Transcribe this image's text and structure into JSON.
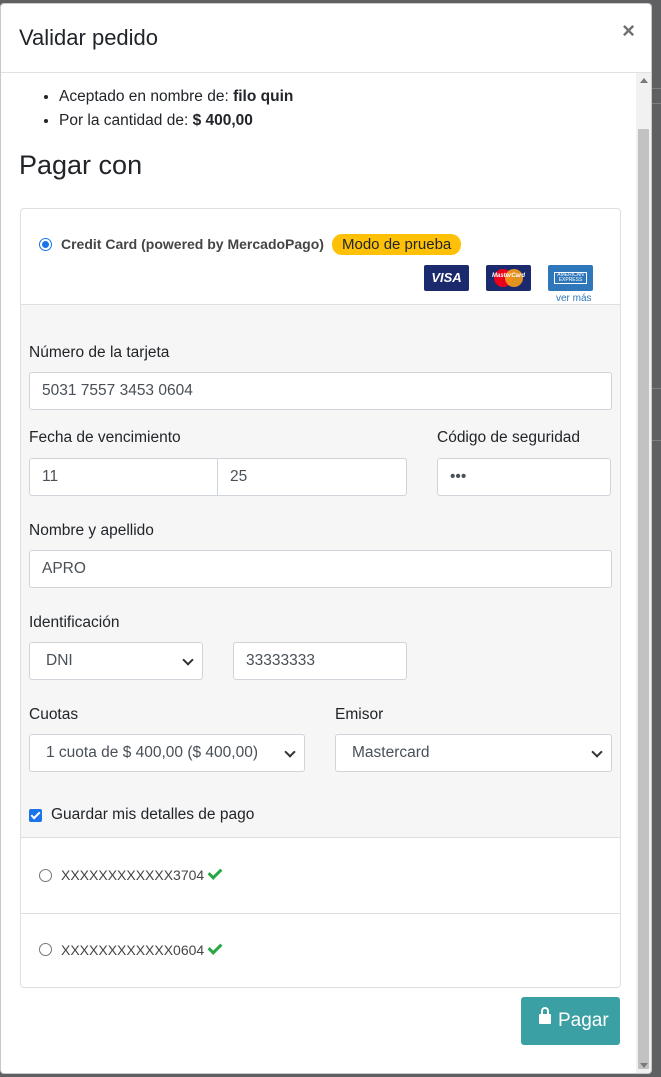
{
  "modal": {
    "title": "Validar pedido",
    "close_label": "×"
  },
  "summary": {
    "accepted_prefix": "Aceptado en nombre de:",
    "accepted_name": "filo quin",
    "amount_prefix": "Por la cantidad de:",
    "amount": "$ 400,00"
  },
  "pay_with_heading": "Pagar con",
  "acquirer": {
    "label": "Credit Card (powered by MercadoPago)",
    "test_badge": "Modo de prueba",
    "selected": true,
    "logos": [
      "visa-logo",
      "mastercard-logo",
      "amex-logo"
    ],
    "visa_text": "VISA",
    "mc_text": "MasterCard",
    "amex_text": "AMERICAN EXPRESS",
    "more_link": "ver más"
  },
  "form": {
    "card_number_label": "Número de la tarjeta",
    "card_number": "5031 7557 3453 0604",
    "expiry_label": "Fecha de vencimiento",
    "expiry_month": "11",
    "expiry_year": "25",
    "security_label": "Código de seguridad",
    "security_code": "•••",
    "name_label": "Nombre y apellido",
    "name_value": "APRO",
    "id_label": "Identificación",
    "id_type": "DNI",
    "id_number": "33333333",
    "installments_label": "Cuotas",
    "installments_value": "1 cuota de $ 400,00 ($ 400,00)",
    "issuer_label": "Emisor",
    "issuer_value": "Mastercard",
    "save_label": "Guardar mis detalles de pago",
    "save_checked": true
  },
  "saved_cards": [
    {
      "label": "XXXXXXXXXXXX3704"
    },
    {
      "label": "XXXXXXXXXXXX0604"
    }
  ],
  "pay_button": "Pagar",
  "colors": {
    "primary": "#3aa0a3",
    "badge": "#ffc107",
    "check": "#28a745",
    "radio": "#1a73e8"
  }
}
